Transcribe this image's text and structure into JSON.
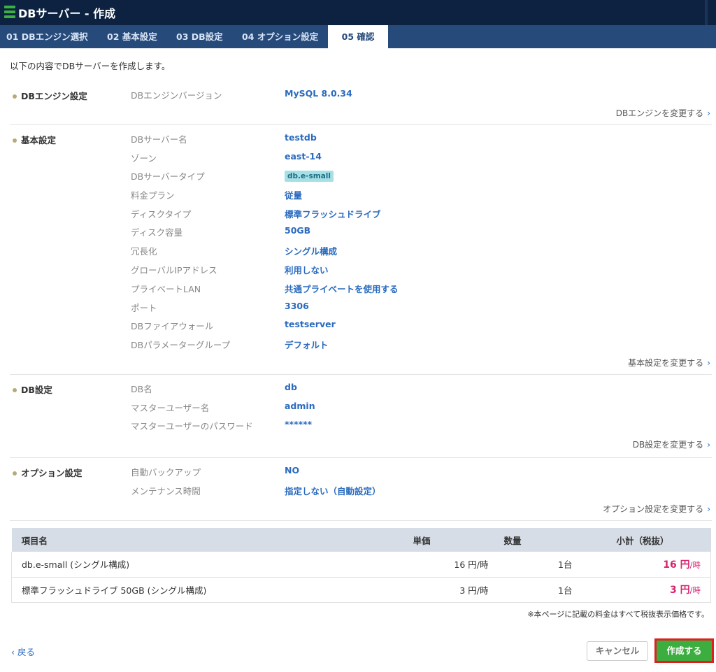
{
  "header": {
    "title": "DBサーバー - 作成"
  },
  "tabs": [
    {
      "label": "01 DBエンジン選択"
    },
    {
      "label": "02 基本設定"
    },
    {
      "label": "03 DB設定"
    },
    {
      "label": "04 オプション設定"
    },
    {
      "label": "05 確認"
    }
  ],
  "intro": "以下の内容でDBサーバーを作成します。",
  "engine": {
    "heading": "DBエンジン設定",
    "rows": [
      {
        "label": "DBエンジンバージョン",
        "value": "MySQL 8.0.34"
      }
    ],
    "change": "DBエンジンを変更する"
  },
  "basic": {
    "heading": "基本設定",
    "rows": [
      {
        "label": "DBサーバー名",
        "value": "testdb"
      },
      {
        "label": "ゾーン",
        "value": "east-14"
      },
      {
        "label": "DBサーバータイプ",
        "value": "db.e-small"
      },
      {
        "label": "料金プラン",
        "value": "従量"
      },
      {
        "label": "ディスクタイプ",
        "value": "標準フラッシュドライブ"
      },
      {
        "label": "ディスク容量",
        "value": "50GB"
      },
      {
        "label": "冗長化",
        "value": "シングル構成"
      },
      {
        "label": "グローバルIPアドレス",
        "value": "利用しない"
      },
      {
        "label": "プライベートLAN",
        "value": "共通プライベートを使用する"
      },
      {
        "label": "ポート",
        "value": "3306"
      },
      {
        "label": "DBファイアウォール",
        "value": "testserver"
      },
      {
        "label": "DBパラメーターグループ",
        "value": "デフォルト"
      }
    ],
    "change": "基本設定を変更する"
  },
  "db": {
    "heading": "DB設定",
    "rows": [
      {
        "label": "DB名",
        "value": "db"
      },
      {
        "label": "マスターユーザー名",
        "value": "admin"
      },
      {
        "label": "マスターユーザーのパスワード",
        "value": "******"
      }
    ],
    "change": "DB設定を変更する"
  },
  "option": {
    "heading": "オプション設定",
    "rows": [
      {
        "label": "自動バックアップ",
        "value": "NO"
      },
      {
        "label": "メンテナンス時間",
        "value": "指定しない（自動設定）"
      }
    ],
    "change": "オプション設定を変更する"
  },
  "price_table": {
    "headers": {
      "item": "項目名",
      "unit_price": "単価",
      "qty": "数量",
      "subtotal": "小計（税抜）"
    },
    "rows": [
      {
        "item": "db.e-small (シングル構成)",
        "unit_price": "16 円/時",
        "qty": "1台",
        "subtotal": "16 円",
        "per": "/時"
      },
      {
        "item": "標準フラッシュドライブ 50GB (シングル構成)",
        "unit_price": "3 円/時",
        "qty": "1台",
        "subtotal": "3 円",
        "per": "/時"
      }
    ],
    "note": "※本ページに記載の料金はすべて税抜表示価格です。"
  },
  "footer": {
    "back": "戻る",
    "cancel": "キャンセル",
    "create": "作成する"
  },
  "icons": {
    "back": "chevron-left-icon",
    "change": "chevron-right-icon"
  },
  "colors": {
    "accent": "#2a6bbf",
    "header": "#0d2240",
    "tabbar": "#264a7a",
    "price": "#d6246e",
    "create": "#3cae3f",
    "highlight": "#e02020"
  }
}
